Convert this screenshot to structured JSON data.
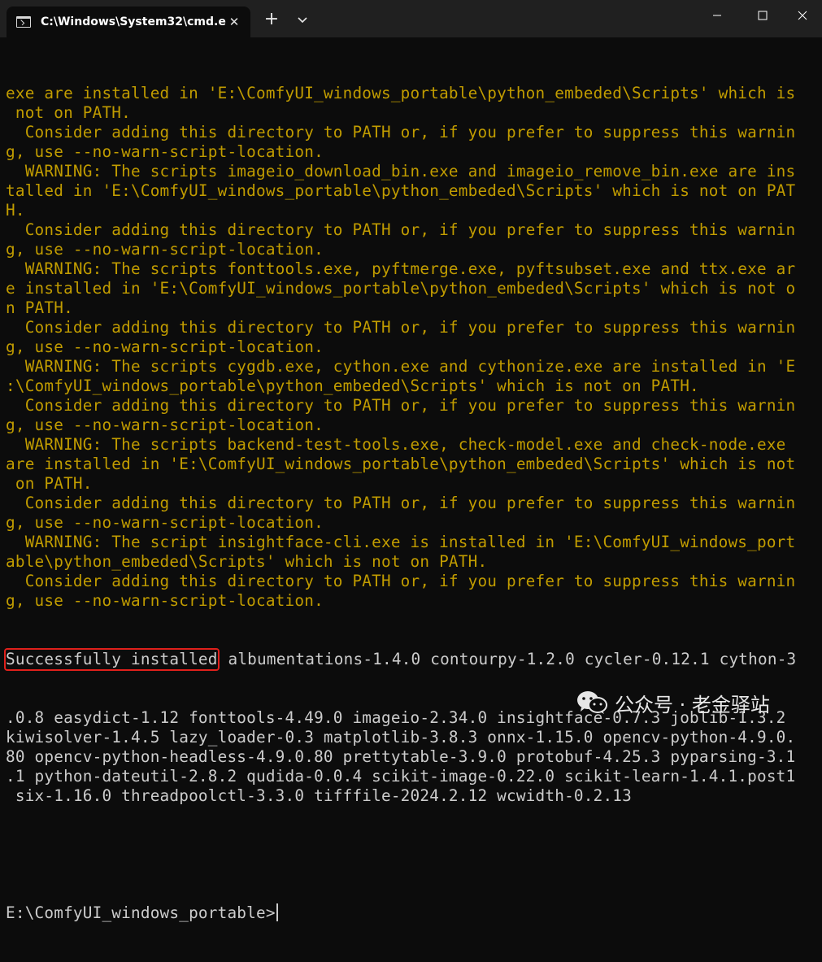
{
  "window": {
    "tab_title": "C:\\Windows\\System32\\cmd.e",
    "tab_close": "✕",
    "new_tab": "+",
    "colors": {
      "titlebar": "#202020",
      "background": "#0c0c0c",
      "warning_text": "#c19c00",
      "normal_text": "#cccccc",
      "highlight_box": "#e0201b"
    }
  },
  "terminal": {
    "warning_lines": [
      "exe are installed in 'E:\\ComfyUI_windows_portable\\python_embeded\\Scripts' which is",
      " not on PATH.",
      "  Consider adding this directory to PATH or, if you prefer to suppress this warnin",
      "g, use --no-warn-script-location.",
      "  WARNING: The scripts imageio_download_bin.exe and imageio_remove_bin.exe are ins",
      "talled in 'E:\\ComfyUI_windows_portable\\python_embeded\\Scripts' which is not on PAT",
      "H.",
      "  Consider adding this directory to PATH or, if you prefer to suppress this warnin",
      "g, use --no-warn-script-location.",
      "  WARNING: The scripts fonttools.exe, pyftmerge.exe, pyftsubset.exe and ttx.exe ar",
      "e installed in 'E:\\ComfyUI_windows_portable\\python_embeded\\Scripts' which is not o",
      "n PATH.",
      "  Consider adding this directory to PATH or, if you prefer to suppress this warnin",
      "g, use --no-warn-script-location.",
      "  WARNING: The scripts cygdb.exe, cython.exe and cythonize.exe are installed in 'E",
      ":\\ComfyUI_windows_portable\\python_embeded\\Scripts' which is not on PATH.",
      "  Consider adding this directory to PATH or, if you prefer to suppress this warnin",
      "g, use --no-warn-script-location.",
      "  WARNING: The scripts backend-test-tools.exe, check-model.exe and check-node.exe",
      "are installed in 'E:\\ComfyUI_windows_portable\\python_embeded\\Scripts' which is not",
      " on PATH.",
      "  Consider adding this directory to PATH or, if you prefer to suppress this warnin",
      "g, use --no-warn-script-location.",
      "  WARNING: The script insightface-cli.exe is installed in 'E:\\ComfyUI_windows_port",
      "able\\python_embeded\\Scripts' which is not on PATH.",
      "  Consider adding this directory to PATH or, if you prefer to suppress this warnin",
      "g, use --no-warn-script-location."
    ],
    "success_label": "Successfully installed",
    "success_rest": " albumentations-1.4.0 contourpy-1.2.0 cycler-0.12.1 cython-3",
    "install_lines": [
      ".0.8 easydict-1.12 fonttools-4.49.0 imageio-2.34.0 insightface-0.7.3 joblib-1.3.2",
      "kiwisolver-1.4.5 lazy_loader-0.3 matplotlib-3.8.3 onnx-1.15.0 opencv-python-4.9.0.",
      "80 opencv-python-headless-4.9.0.80 prettytable-3.9.0 protobuf-4.25.3 pyparsing-3.1",
      ".1 python-dateutil-2.8.2 qudida-0.0.4 scikit-image-0.22.0 scikit-learn-1.4.1.post1",
      " six-1.16.0 threadpoolctl-3.3.0 tifffile-2024.2.12 wcwidth-0.2.13"
    ],
    "prompt": "E:\\ComfyUI_windows_portable>"
  },
  "watermark": {
    "text": "公众号 · 老金驿站",
    "icon": "wechat-icon"
  }
}
